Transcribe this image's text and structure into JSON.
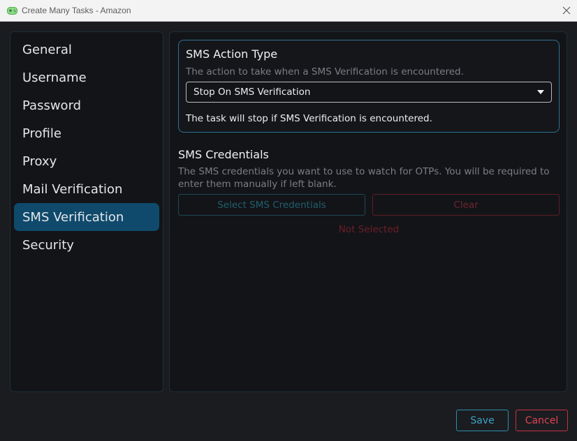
{
  "window": {
    "title": "Create Many Tasks - Amazon",
    "app_icon": "gamepad-icon",
    "close_icon": "close-icon"
  },
  "sidebar": {
    "items": [
      {
        "label": "General",
        "active": false
      },
      {
        "label": "Username",
        "active": false
      },
      {
        "label": "Password",
        "active": false
      },
      {
        "label": "Profile",
        "active": false
      },
      {
        "label": "Proxy",
        "active": false
      },
      {
        "label": "Mail Verification",
        "active": false
      },
      {
        "label": "SMS Verification",
        "active": true
      },
      {
        "label": "Security",
        "active": false
      }
    ]
  },
  "sms_action": {
    "title": "SMS Action Type",
    "description": "The action to take when a SMS Verification is encountered.",
    "selected": "Stop On SMS Verification",
    "note": "The task will stop if SMS Verification is encountered."
  },
  "sms_credentials": {
    "title": "SMS Credentials",
    "description_line1": "The SMS credentials you want to use to watch for OTPs. You will be required to",
    "description_line2": "enter them manually if left blank.",
    "select_label": "Select SMS Credentials",
    "clear_label": "Clear",
    "status": "Not Selected"
  },
  "footer": {
    "save_label": "Save",
    "cancel_label": "Cancel"
  },
  "colors": {
    "accent": "#0f4a6c",
    "save": "#3aa4c2",
    "cancel": "#e04456"
  }
}
